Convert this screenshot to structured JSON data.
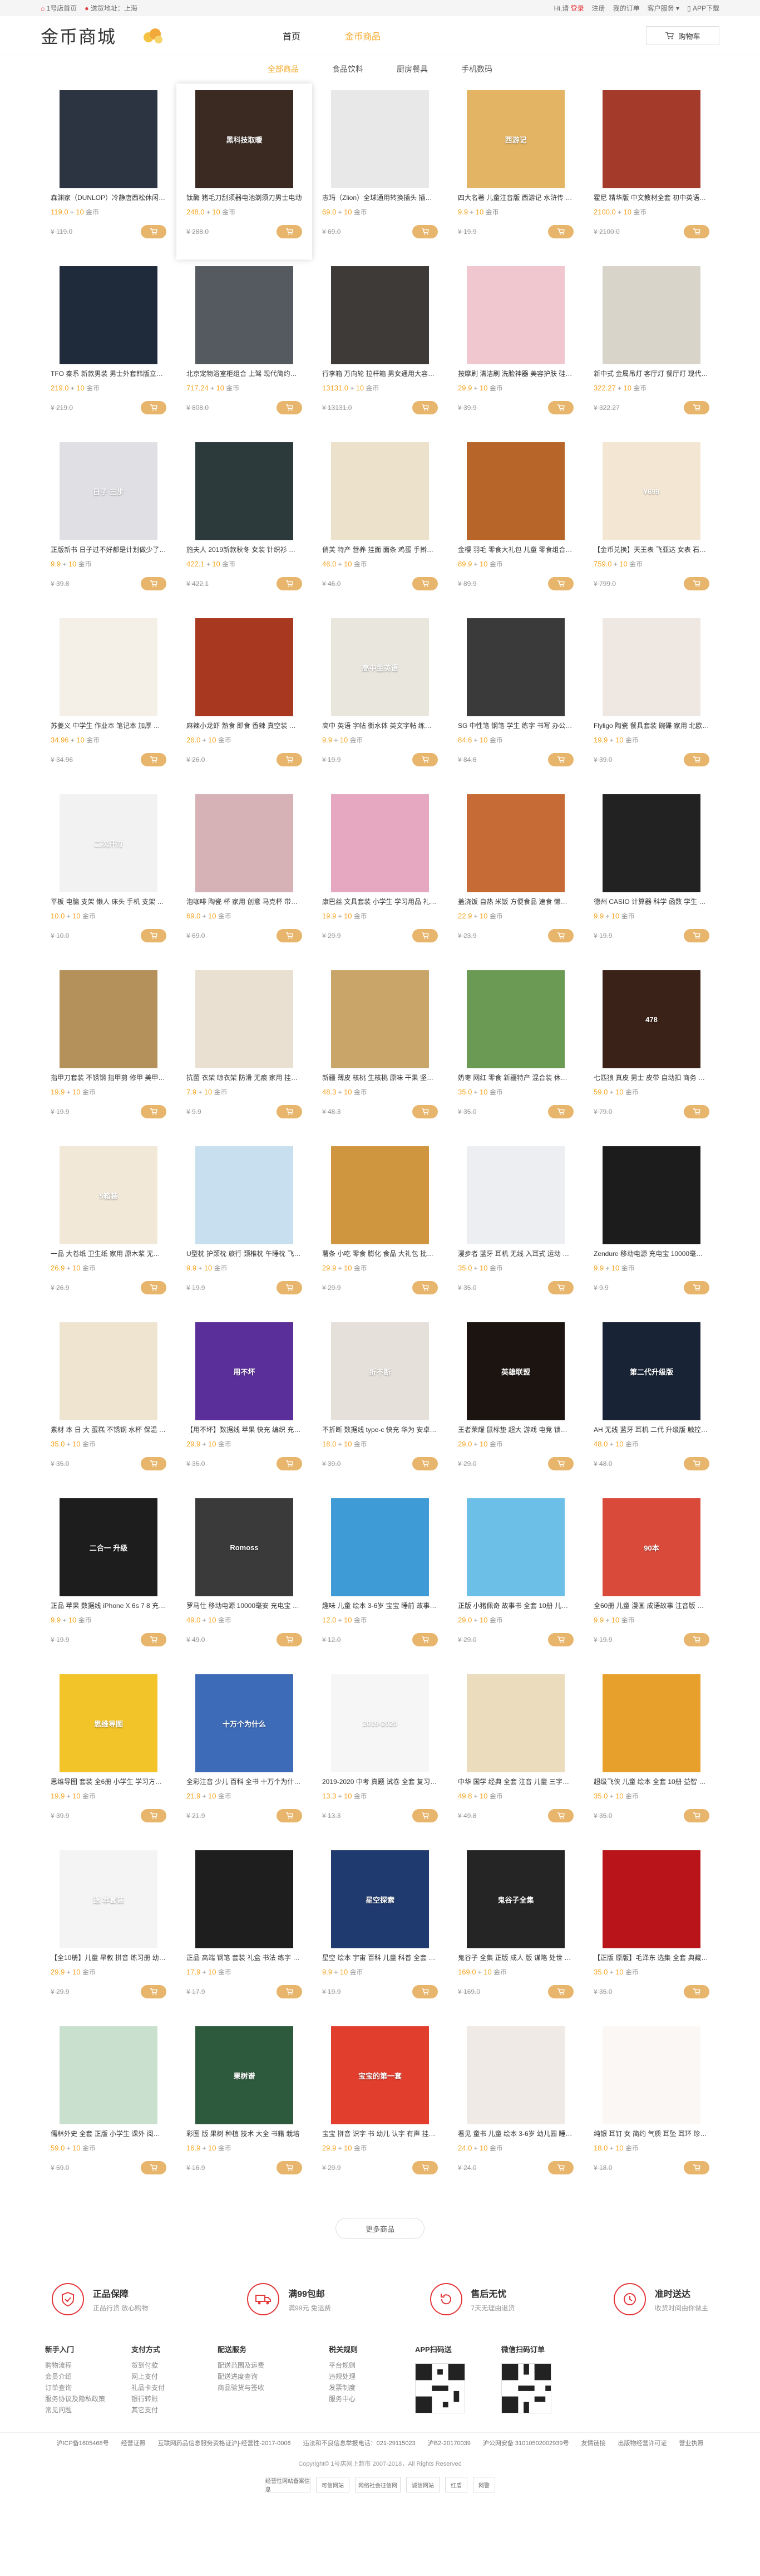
{
  "topbar": {
    "home": "1号店首页",
    "location_label": "送货地址：",
    "location": "上海",
    "login_hi": "Hi,请",
    "login": "登录",
    "register": "注册",
    "orders": "我的订单",
    "service": "客户服务",
    "app": "APP下载"
  },
  "header": {
    "logo": "金币商城",
    "nav": [
      "首页",
      "金币商品"
    ],
    "cart": "购物车"
  },
  "subnav": [
    "全部商品",
    "食品饮料",
    "厨房餐具",
    "手机数码"
  ],
  "unit": "金币",
  "coin": "10",
  "plus": "+",
  "products": [
    {
      "name": "森渊家（DUNLOP）冷静唐西松休闲裤男",
      "price": "119.0",
      "orig": "¥ 119.0",
      "bg": "#2b3440",
      "label": ""
    },
    {
      "name": "钛酶 猪毛刀刮须器电池剃须刀男士电动",
      "price": "248.0",
      "orig": "¥ 288.0",
      "bg": "#3a2a22",
      "label": "黑科技取暖"
    },
    {
      "name": "志玛（Zlion）全球通用转换插头 插座 旅行",
      "price": "69.0",
      "orig": "¥ 69.0",
      "bg": "#e8e8e8",
      "label": ""
    },
    {
      "name": "四大名著 儿童注音版 西游记 水浒传 红楼梦",
      "price": "9.9",
      "orig": "¥ 19.9",
      "bg": "#e3b463",
      "label": "西游记"
    },
    {
      "name": "霍尼 精华版 中文教材全套 初中英语大全",
      "price": "2100.0",
      "orig": "¥ 2100.0",
      "bg": "#a43a2a",
      "label": ""
    },
    {
      "name": "TFO 秦系 新款男装 男士外套韩版立领夹克",
      "price": "219.0",
      "orig": "¥ 219.0",
      "bg": "#1f2a3a",
      "label": ""
    },
    {
      "name": "北京宠物浴室柜组合 上驾 现代简约卫生间小户型",
      "price": "717.24",
      "orig": "¥ 808.0",
      "bg": "#555a60",
      "label": ""
    },
    {
      "name": "行李箱 万向轮 拉杆箱 男女通用大容量 登机箱",
      "price": "13131.0",
      "orig": "¥ 13131.0",
      "bg": "#3e3a38",
      "label": ""
    },
    {
      "name": "按摩刷 清洁刷 洗脸神器 美容护肤 硅胶洗脸刷",
      "price": "29.9",
      "orig": "¥ 39.9",
      "bg": "#f0c6cf",
      "label": ""
    },
    {
      "name": "新中式 金属吊灯 客厅灯 餐厅灯 现代简约卧室",
      "price": "322.27",
      "orig": "¥ 322.27",
      "bg": "#d9d4c9",
      "label": ""
    },
    {
      "name": "正版新书 日子过不好都是计划做少了 自我管理",
      "price": "9.9",
      "orig": "¥ 39.8",
      "bg": "#dfdfe4",
      "label": "日子 三步"
    },
    {
      "name": "施夫人 2019新款秋冬 女装 针织衫 打底衫上衣",
      "price": "422.1",
      "orig": "¥ 422.1",
      "bg": "#2d3a3c",
      "label": ""
    },
    {
      "name": "俏芙 特产 营养 挂面 面条 鸡蛋 手擀面 细面",
      "price": "46.0",
      "orig": "¥ 46.0",
      "bg": "#ece2cc",
      "label": ""
    },
    {
      "name": "金樱 羽毛 零食大礼包 儿童 零食组合 网红",
      "price": "89.9",
      "orig": "¥ 89.9",
      "bg": "#b8652a",
      "label": ""
    },
    {
      "name": "【金币兑换】天王表 飞亚达 女表 石英表 时尚",
      "price": "759.0",
      "orig": "¥ 799.0",
      "bg": "#f3e6d2",
      "label": "¥699"
    },
    {
      "name": "苏姜义 中学生 作业本 笔记本 加厚 学生用品",
      "price": "34.96",
      "orig": "¥ 34.96",
      "bg": "#f4f0e8",
      "label": ""
    },
    {
      "name": "麻辣小龙虾 熟食 即食 香辣 真空装 零食 卤味",
      "price": "26.0",
      "orig": "¥ 26.0",
      "bg": "#a8381f",
      "label": ""
    },
    {
      "name": "高中 英语 字帖 衡水体 英文字帖 练字本 学生",
      "price": "9.9",
      "orig": "¥ 19.9",
      "bg": "#e9e6de",
      "label": "高中生英语"
    },
    {
      "name": "SG 中性笔 钢笔 学生 练字 书写 办公用品 黑色",
      "price": "84.6",
      "orig": "¥ 84.6",
      "bg": "#3a3a3a",
      "label": ""
    },
    {
      "name": "Flyligo 陶瓷 餐具套装 碗碟 家用 北欧风 餐具",
      "price": "19.9",
      "orig": "¥ 39.0",
      "bg": "#efe7e1",
      "label": ""
    },
    {
      "name": "平板 电脑 支架 懒人 床头 手机 支架 桌面 多功能",
      "price": "10.0",
      "orig": "¥ 10.0",
      "bg": "#f2f2f2",
      "label": "二次开刃"
    },
    {
      "name": "泡咖啡 陶瓷 杯 家用 创意 马克杯 带盖 勺",
      "price": "69.0",
      "orig": "¥ 69.0",
      "bg": "#d6b1b6",
      "label": ""
    },
    {
      "name": "康巴丝 文具套装 小学生 学习用品 礼盒 铅笔",
      "price": "19.9",
      "orig": "¥ 29.9",
      "bg": "#e6a8c0",
      "label": ""
    },
    {
      "name": "盖浇饭 自热 米饭 方便食品 速食 懒人 午餐肉",
      "price": "22.9",
      "orig": "¥ 23.9",
      "bg": "#c66b35",
      "label": ""
    },
    {
      "name": "德州 CASIO 计算器 科学 函数 学生 考试 专用",
      "price": "9.9",
      "orig": "¥ 19.9",
      "bg": "#222",
      "label": ""
    },
    {
      "name": "指甲刀套装 不锈钢 指甲剪 修甲 美甲 工具 12件",
      "price": "19.9",
      "orig": "¥ 19.9",
      "bg": "#b4915a",
      "label": ""
    },
    {
      "name": "抗菌 衣架 晾衣架 防滑 无痕 家用 挂衣架",
      "price": "7.9",
      "orig": "¥ 9.9",
      "bg": "#e9e0d2",
      "label": ""
    },
    {
      "name": "新疆 薄皮 核桃 生核桃 原味 干果 坚果 零食",
      "price": "48.3",
      "orig": "¥ 48.3",
      "bg": "#caa56a",
      "label": ""
    },
    {
      "name": "奶枣 网红 零食 新疆特产 混合装 休闲食品",
      "price": "35.0",
      "orig": "¥ 35.0",
      "bg": "#6b9a54",
      "label": ""
    },
    {
      "name": "七匹狼 真皮 男士 皮带 自动扣 商务 腰带",
      "price": "59.0",
      "orig": "¥ 79.0",
      "bg": "#3b2218",
      "label": "478"
    },
    {
      "name": "一品 大卷纸 卫生纸 家用 原木浆 无芯卷纸",
      "price": "26.9",
      "orig": "¥ 26.9",
      "bg": "#f1e8d8",
      "label": "5箱装"
    },
    {
      "name": "U型枕 护颈枕 旅行 颈椎枕 午睡枕 飞机 便携",
      "price": "9.9",
      "orig": "¥ 19.9",
      "bg": "#c8dff0",
      "label": ""
    },
    {
      "name": "薯条 小吃 零食 膨化 食品 大礼包 批发 整箱",
      "price": "29.9",
      "orig": "¥ 29.9",
      "bg": "#d0963f",
      "label": ""
    },
    {
      "name": "漫步者 蓝牙 耳机 无线 入耳式 运动 降噪",
      "price": "35.0",
      "orig": "¥ 35.0",
      "bg": "#eceef1",
      "label": ""
    },
    {
      "name": "Zendure 移动电源 充电宝 10000毫安 快充",
      "price": "9.9",
      "orig": "¥ 9.9",
      "bg": "#1c1c1c",
      "label": ""
    },
    {
      "name": "素材 本 日 大 蛋糕 不锈钢 水杯 保温 便携",
      "price": "35.0",
      "orig": "¥ 35.0",
      "bg": "#efe4d0",
      "label": ""
    },
    {
      "name": "【用不坏】数据线 苹果 快充 编织 充电线",
      "price": "29.9",
      "orig": "¥ 35.0",
      "bg": "#5b2f9a",
      "label": "用不坏"
    },
    {
      "name": "不折断 数据线 type-c 快充 华为 安卓 通用",
      "price": "18.0",
      "orig": "¥ 39.0",
      "bg": "#e5e0da",
      "label": "折不断"
    },
    {
      "name": "王者荣耀 鼠标垫 超大 游戏 电竞 锁边 桌垫",
      "price": "29.0",
      "orig": "¥ 29.0",
      "bg": "#1c1410",
      "label": "英雄联盟"
    },
    {
      "name": "AH 无线 蓝牙 耳机 二代 升级版 触控 降噪",
      "price": "48.0",
      "orig": "¥ 48.0",
      "bg": "#182436",
      "label": "第二代升级版"
    },
    {
      "name": "正品 苹果 数据线 iPhone X 6s 7 8 充电线",
      "price": "9.9",
      "orig": "¥ 19.9",
      "bg": "#1d1d1d",
      "label": "二合一 升级"
    },
    {
      "name": "罗马仕 移动电源 10000毫安 充电宝 大容量",
      "price": "49.0",
      "orig": "¥ 49.0",
      "bg": "#3a3a3a",
      "label": "Romoss"
    },
    {
      "name": "趣味 儿童 绘本 3-6岁 宝宝 睡前 故事书 注音",
      "price": "12.0",
      "orig": "¥ 12.0",
      "bg": "#3e9bd6",
      "label": ""
    },
    {
      "name": "正版 小猪佩奇 故事书 全套 10册 儿童绘本",
      "price": "29.0",
      "orig": "¥ 29.0",
      "bg": "#6cc0e8",
      "label": ""
    },
    {
      "name": "全60册 儿童 漫画 成语故事 注音版 小学生",
      "price": "9.9",
      "orig": "¥ 19.9",
      "bg": "#d94a3a",
      "label": "90本"
    },
    {
      "name": "思维导图 套装 全6册 小学生 学习方法 书籍",
      "price": "19.9",
      "orig": "¥ 39.9",
      "bg": "#f2c42a",
      "label": "思维导图"
    },
    {
      "name": "全彩注音 少儿 百科 全书 十万个为什么 4册",
      "price": "21.9",
      "orig": "¥ 21.9",
      "bg": "#3d6bb8",
      "label": "十万个为什么"
    },
    {
      "name": "2019-2020 中考 真题 试卷 全套 复习资料",
      "price": "13.3",
      "orig": "¥ 13.3",
      "bg": "#f6f6f6",
      "label": "2019-2020"
    },
    {
      "name": "中华 国学 经典 全套 注音 儿童 三字经 弟子规",
      "price": "49.8",
      "orig": "¥ 49.8",
      "bg": "#eadcbd",
      "label": ""
    },
    {
      "name": "超级飞侠 儿童 绘本 全套 10册 益智 故事书",
      "price": "35.0",
      "orig": "¥ 35.0",
      "bg": "#e8a02c",
      "label": ""
    },
    {
      "name": "【全10册】儿童 早教 拼音 练习册 幼小衔接",
      "price": "29.9",
      "orig": "¥ 29.9",
      "bg": "#f4f4f4",
      "label": "送 本套装"
    },
    {
      "name": "正品 高端 钢笔 套装 礼盒 书法 练字 签字笔",
      "price": "17.9",
      "orig": "¥ 17.9",
      "bg": "#1e1e1e",
      "label": ""
    },
    {
      "name": "星空 绘本 宇宙 百科 儿童 科普 全套 6册",
      "price": "9.9",
      "orig": "¥ 19.9",
      "bg": "#1f3a6e",
      "label": "星空探索"
    },
    {
      "name": "鬼谷子 全集 正版 成人 版 谋略 处世 智慧 书籍",
      "price": "169.0",
      "orig": "¥ 169.0",
      "bg": "#252525",
      "label": "鬼谷子全集"
    },
    {
      "name": "【正版 原版】毛泽东 选集 全套 典藏 版",
      "price": "35.0",
      "orig": "¥ 35.0",
      "bg": "#b9141a",
      "label": ""
    },
    {
      "name": "儒林外史 全套 正版 小学生 课外 阅读 书籍",
      "price": "59.0",
      "orig": "¥ 59.0",
      "bg": "#c9e0cf",
      "label": ""
    },
    {
      "name": "彩图 版 果树 种植 技术 大全 书籍 栽培",
      "price": "16.9",
      "orig": "¥ 16.9",
      "bg": "#2d5a3c",
      "label": "果树谱"
    },
    {
      "name": "宝宝 拼音 识字 书 幼儿 认字 有声 挂图 早教",
      "price": "29.9",
      "orig": "¥ 29.9",
      "bg": "#e23e2e",
      "label": "宝宝的第一套"
    },
    {
      "name": "看见 童书 儿童 绘本 3-6岁 幼儿园 睡前 故事",
      "price": "24.0",
      "orig": "¥ 24.0",
      "bg": "#f0eae6",
      "label": ""
    },
    {
      "name": "纯银 耳钉 女 简约 气质 耳坠 耳环 珍珠 饰品",
      "price": "18.0",
      "orig": "¥ 18.0",
      "bg": "#fbf7f5",
      "label": ""
    }
  ],
  "more": "更多商品",
  "services": [
    {
      "title": "正品保障",
      "sub": "正品行货 放心购物",
      "icon": "shield-icon"
    },
    {
      "title": "满99包邮",
      "sub": "满99元 免运费",
      "icon": "truck-icon"
    },
    {
      "title": "售后无忧",
      "sub": "7天无理由退货",
      "icon": "refund-icon"
    },
    {
      "title": "准时送达",
      "sub": "收货时间由你做主",
      "icon": "clock-icon"
    }
  ],
  "footer_cols": [
    {
      "title": "新手入门",
      "items": [
        "购物流程",
        "会员介绍",
        "订单查询",
        "服务协议及隐私政策",
        "常见问题"
      ]
    },
    {
      "title": "支付方式",
      "items": [
        "货到付款",
        "网上支付",
        "礼品卡支付",
        "银行转账",
        "其它支付"
      ]
    },
    {
      "title": "配送服务",
      "items": [
        "配送范围及运费",
        "配送进度查询",
        "商品验货与签收"
      ]
    },
    {
      "title": "税关规则",
      "items": [
        "平台规则",
        "违规处理",
        "发票制度",
        "服务中心"
      ]
    },
    {
      "title": "APP扫码送",
      "items": []
    },
    {
      "title": "微信扫码订单",
      "items": []
    }
  ],
  "footer_bar": [
    "沪ICP备1605468号",
    "经营证照",
    "互联网药品信息服务资格证沪]-经营性-2017-0006",
    "违法和不良信息举报电话：021-29115023",
    "沪B2-20170039",
    "沪公网安备 31010502002939号",
    "友情链接",
    "出版物经营许可证",
    "营业执照"
  ],
  "copyright": "Copyright© 1号店网上超市 2007-2018，All Rights Reserved",
  "badges": [
    "经营性网站备案信息",
    "可信网站",
    "网络社会征信网",
    "诚信网站",
    "红盾",
    "网警"
  ],
  "colors": {
    "accent": "#f5a623",
    "buy_btn": "#e7b56c",
    "red": "#e4393c"
  }
}
